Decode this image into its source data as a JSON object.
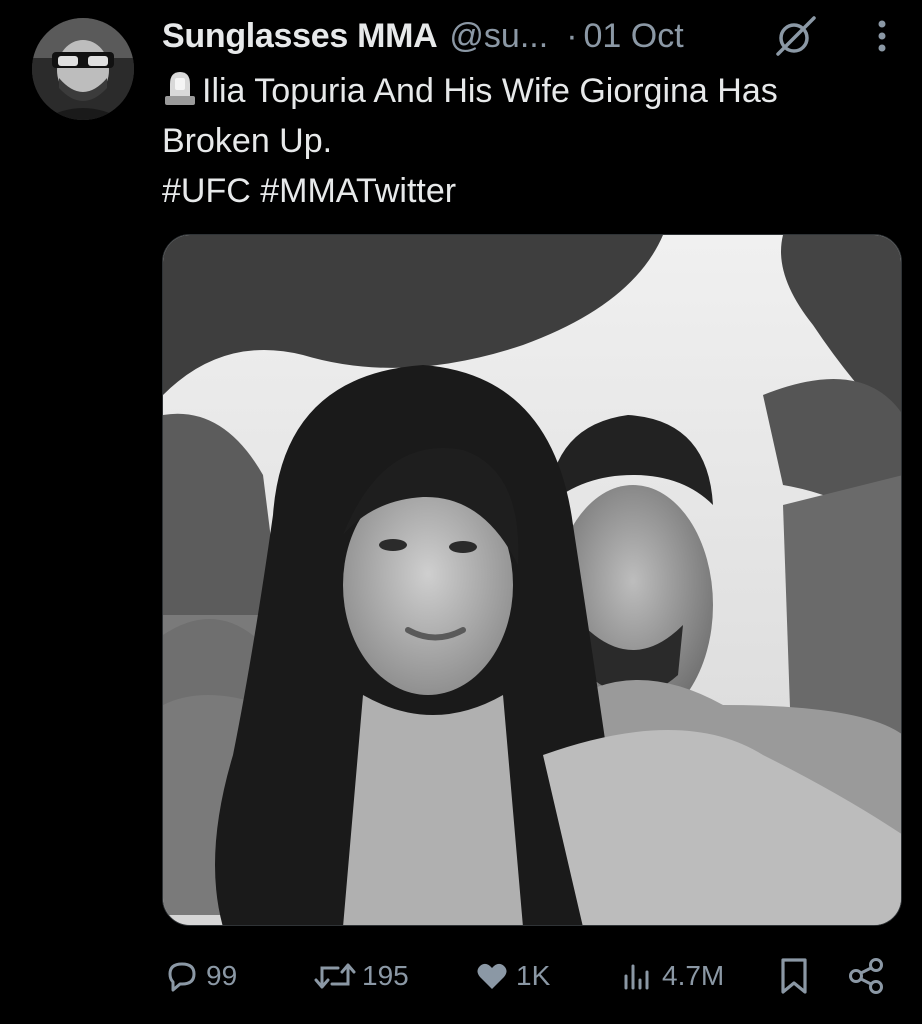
{
  "author": {
    "display_name": "Sunglasses MMA",
    "handle": "@su...",
    "separator": "·",
    "date": "01 Oct",
    "avatar_icon": "profile-avatar"
  },
  "tweet": {
    "emoji_icon": "police-light-emoji",
    "line1": "Ilia Topuria And His Wife Giorgina Has",
    "line2": "Broken Up.",
    "hashtags": "#UFC #MMATwitter"
  },
  "media": {
    "kind": "photo",
    "tone": "black-and-white"
  },
  "actions": {
    "replies": "99",
    "reposts": "195",
    "likes": "1K",
    "views": "4.7M"
  },
  "colors": {
    "background": "#000000",
    "text": "#e7e9ea",
    "muted": "#8b98a5"
  }
}
